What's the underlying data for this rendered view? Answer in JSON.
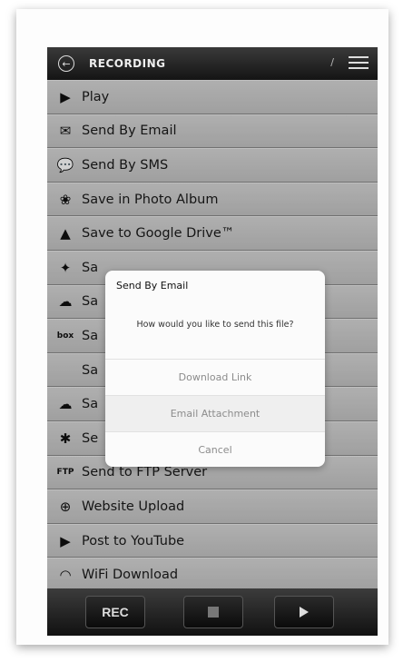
{
  "header": {
    "title": "RECORDING",
    "back_icon": "back-arrow-icon",
    "edit_icon": "pencil-icon",
    "menu_icon": "list-menu-icon"
  },
  "menu": {
    "items": [
      {
        "label": "Play",
        "icon": "play-circle-icon",
        "glyph": "▶"
      },
      {
        "label": "Send By Email",
        "icon": "envelope-icon",
        "glyph": "✉"
      },
      {
        "label": "Send By SMS",
        "icon": "chat-bubble-icon",
        "glyph": "💬"
      },
      {
        "label": "Save in Photo Album",
        "icon": "photo-album-icon",
        "glyph": "❀"
      },
      {
        "label": "Save to Google Drive™",
        "icon": "google-drive-icon",
        "glyph": "▲"
      },
      {
        "label": "Sa",
        "icon": "dropbox-icon",
        "glyph": "✦"
      },
      {
        "label": "Sa",
        "icon": "cloud-service-icon",
        "glyph": "☁"
      },
      {
        "label": "Sa",
        "icon": "box-icon",
        "glyph": "box"
      },
      {
        "label": "Sa",
        "icon": "apple-icon",
        "glyph": ""
      },
      {
        "label": "Sa",
        "icon": "soundcloud-icon",
        "glyph": "☁"
      },
      {
        "label": "Se",
        "icon": "bluetooth-icon",
        "glyph": "✱"
      },
      {
        "label": "Send to FTP Server",
        "icon": "ftp-icon",
        "glyph": "FTP"
      },
      {
        "label": "Website Upload",
        "icon": "globe-icon",
        "glyph": "⊕"
      },
      {
        "label": "Post to YouTube",
        "icon": "youtube-icon",
        "glyph": "▶"
      },
      {
        "label": "WiFi Download",
        "icon": "wifi-icon",
        "glyph": "◠"
      }
    ]
  },
  "dialog": {
    "title": "Send By Email",
    "message": "How would you like to send this file?",
    "options": [
      "Download Link",
      "Email Attachment",
      "Cancel"
    ]
  },
  "controls": {
    "rec_label": "REC",
    "stop_icon": "stop-icon",
    "play_icon": "play-icon"
  }
}
